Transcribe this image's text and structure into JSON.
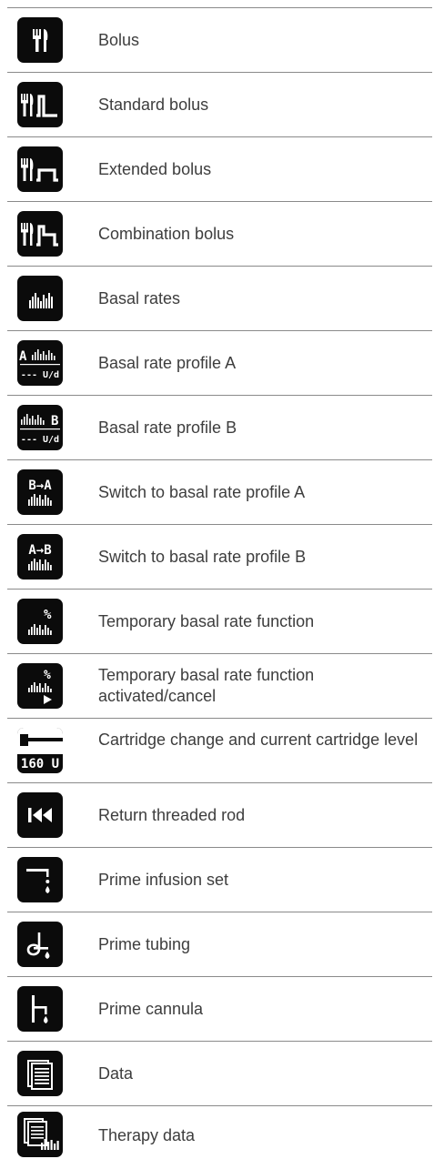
{
  "items": [
    {
      "icon": "bolus-icon",
      "label": "Bolus"
    },
    {
      "icon": "standard-bolus-icon",
      "label": "Standard bolus"
    },
    {
      "icon": "extended-bolus-icon",
      "label": "Extended bolus"
    },
    {
      "icon": "combination-bolus-icon",
      "label": "Combination bolus"
    },
    {
      "icon": "basal-rates-icon",
      "label": "Basal rates"
    },
    {
      "icon": "basal-rate-profile-a-icon",
      "label": "Basal rate profile A",
      "icon_text": [
        "A",
        "--- U/d"
      ]
    },
    {
      "icon": "basal-rate-profile-b-icon",
      "label": "Basal rate profile B",
      "icon_text": [
        "B",
        "--- U/d"
      ]
    },
    {
      "icon": "switch-to-profile-a-icon",
      "label": "Switch to basal rate profile A",
      "icon_text": [
        "B→A"
      ]
    },
    {
      "icon": "switch-to-profile-b-icon",
      "label": "Switch to basal rate profile B",
      "icon_text": [
        "A→B"
      ]
    },
    {
      "icon": "temporary-basal-rate-icon",
      "label": "Temporary basal rate function",
      "icon_text": [
        "%"
      ]
    },
    {
      "icon": "temporary-basal-rate-activated-icon",
      "label": "Temporary basal rate function activated/cancel",
      "icon_text": [
        "%"
      ]
    },
    {
      "icon": "cartridge-level-icon",
      "label": "Cartridge change and current cartridge level",
      "icon_text": [
        "160 U"
      ]
    },
    {
      "icon": "return-threaded-rod-icon",
      "label": "Return threaded rod"
    },
    {
      "icon": "prime-infusion-set-icon",
      "label": "Prime infusion set"
    },
    {
      "icon": "prime-tubing-icon",
      "label": "Prime tubing"
    },
    {
      "icon": "prime-cannula-icon",
      "label": "Prime cannula"
    },
    {
      "icon": "data-icon",
      "label": "Data"
    },
    {
      "icon": "therapy-data-icon",
      "label": "Therapy data"
    }
  ]
}
